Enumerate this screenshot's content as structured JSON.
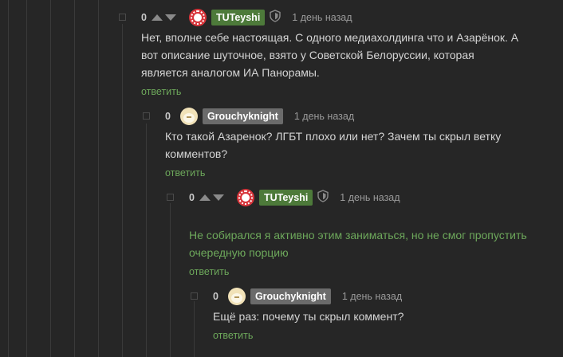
{
  "comments": [
    {
      "rating": "0",
      "author": "TUTeyshi",
      "date": "1 день назад",
      "text": "Нет, вполне себе настоящая. С одного медиахолдинга что и Азарёнок. А вот описание шуточное, взято у Советской Белоруссии, которая является аналогом ИА Панорамы.",
      "reply": "ответить"
    },
    {
      "rating": "0",
      "author": "Grouchyknight",
      "date": "1 день назад",
      "text": "Кто такой Азаренок? ЛГБТ плохо или нет? Зачем ты скрыл ветку комментов?",
      "reply": "ответить"
    },
    {
      "rating": "0",
      "author": "TUTeyshi",
      "date": "1 день назад",
      "text": "Не собирался я активно этим заниматься, но не смог пропустить очередную порцию",
      "reply": "ответить"
    },
    {
      "rating": "0",
      "author": "Grouchyknight",
      "date": "1 день назад",
      "text": "Ещё раз: почему ты скрыл коммент?",
      "reply": "ответить"
    }
  ],
  "icons": {
    "avatar_red": "avatar-icon",
    "avatar_cat": "avatar-icon",
    "shield": "shield-icon",
    "up": "upvote-icon",
    "down": "downvote-icon"
  },
  "colors": {
    "background": "#262626",
    "accent_green": "#6da85b",
    "nick_green": "#4d7a3a",
    "nick_gray": "#6b6b6b"
  }
}
